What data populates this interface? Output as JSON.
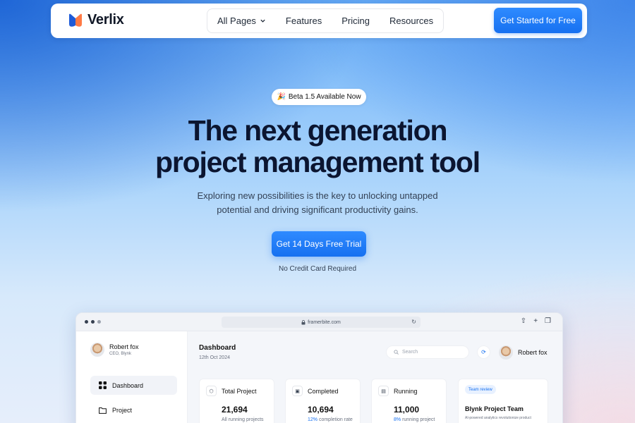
{
  "brand": {
    "name": "Verlix",
    "accent": "#1670f0",
    "logo_left": "#1e5bd8",
    "logo_right": "#ff7a45"
  },
  "nav": {
    "items": [
      {
        "label": "All Pages",
        "has_dropdown": true
      },
      {
        "label": "Features"
      },
      {
        "label": "Pricing"
      },
      {
        "label": "Resources"
      }
    ],
    "cta": "Get Started for Free"
  },
  "hero": {
    "badge_emoji": "🎉",
    "badge": "Beta 1.5 Available Now",
    "title_line1": "The next generation",
    "title_line2": "project management tool",
    "subtitle_line1": "Exploring new possibilities is the key to unlocking untapped",
    "subtitle_line2": "potential and driving significant productivity gains.",
    "cta": "Get 14 Days Free Trial",
    "note": "No Credit Card Required"
  },
  "browser": {
    "url": "framerbite.com"
  },
  "sidebar": {
    "user_name": "Robert fox",
    "user_role": "CEO, Blynk",
    "items": [
      {
        "label": "Dashboard",
        "icon": "grid-icon",
        "active": true
      },
      {
        "label": "Project",
        "icon": "folder-icon",
        "active": false
      }
    ]
  },
  "dashboard": {
    "title": "Dashboard",
    "date": "12th Oct 2024",
    "search_placeholder": "Search",
    "user_name": "Robert fox",
    "cards": [
      {
        "title": "Total Project",
        "value": "21,694",
        "desc": "All running projects",
        "highlight": ""
      },
      {
        "title": "Completed",
        "value": "10,694",
        "desc": " completion rate",
        "highlight": "12%"
      },
      {
        "title": "Running",
        "value": "11,000",
        "desc": " running project",
        "highlight": "8%"
      }
    ],
    "team": {
      "pill": "Team review",
      "title": "Blynk Project Team",
      "desc": "AI-powered analytics revolutionize product"
    }
  }
}
